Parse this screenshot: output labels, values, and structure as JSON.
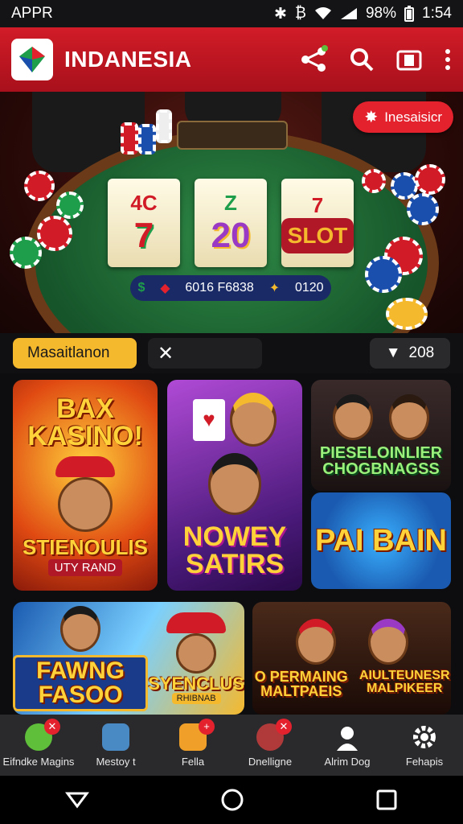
{
  "status_bar": {
    "carrier": "AΡPR",
    "battery": "98%",
    "time": "1:54"
  },
  "app": {
    "title": "INDANESIA"
  },
  "hero": {
    "promo_label": "Inesaisicr",
    "reels": [
      {
        "top": "4C",
        "main": "7"
      },
      {
        "top": "Z",
        "main": "20"
      },
      {
        "top": "7",
        "main": "SLOT"
      }
    ],
    "jackpot_left": "6016 F6838",
    "jackpot_right": "0120"
  },
  "filter": {
    "selected": "Masaitlanon",
    "counter": "208"
  },
  "cards": [
    {
      "title": "BAX KASINO!",
      "subtitle": "STIENOULIS",
      "caption": "UTY RAND"
    },
    {
      "title": "NOWEY SATIRS"
    },
    {
      "title": "PIESELOINLIER CHOGBNAGSS"
    },
    {
      "title": "PAI BAIN"
    },
    {
      "title": "FAWNG FASOO",
      "subtitle": "SYENCLUS",
      "caption": "RHIBNAB"
    },
    {
      "title": "O PERMAING MALTPAEIS",
      "subtitle": "AIULTEUNESR MALPIKEER"
    }
  ],
  "bottom_nav": [
    {
      "label": "Eifndke Magins",
      "icon": "mascot-icon",
      "color": "#5fbf3a"
    },
    {
      "label": "Mestoy t",
      "icon": "chair-icon",
      "color": "#4a8ac4"
    },
    {
      "label": "Fella",
      "icon": "folder-icon",
      "color": "#f0a028"
    },
    {
      "label": "Dnelligne",
      "icon": "gamer-icon",
      "color": "#b03a3a"
    },
    {
      "label": "Alrim Dog",
      "icon": "profile-icon",
      "color": "#ffffff"
    },
    {
      "label": "Fehapis",
      "icon": "gear-icon",
      "color": "#ffffff"
    }
  ],
  "colors": {
    "brand_red": "#d11c28",
    "accent_gold": "#f5b92e",
    "felt_green": "#2f8a46"
  }
}
